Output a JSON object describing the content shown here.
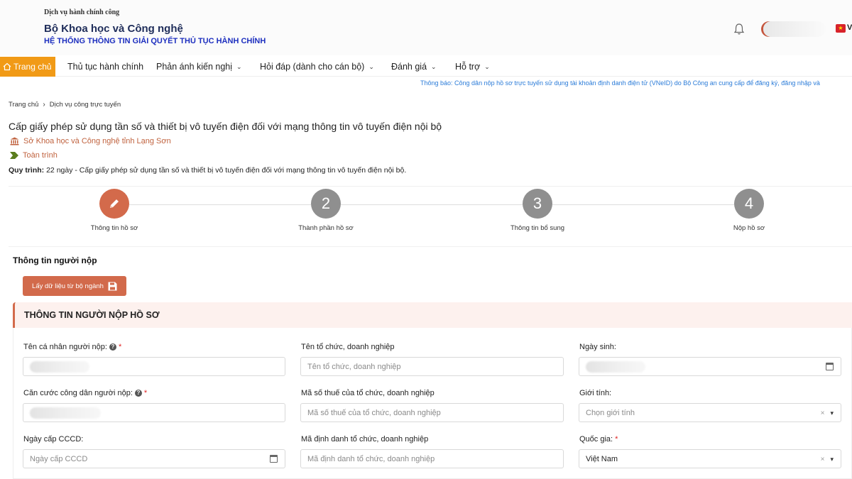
{
  "header": {
    "kicker": "Dịch vụ hành chính công",
    "ministry": "Bộ Khoa học và Công nghệ",
    "system": "HỆ THỐNG THÔNG TIN GIẢI QUYẾT THỦ TỤC HÀNH CHÍNH",
    "lang": "V"
  },
  "nav": {
    "home": "Trang chủ",
    "items": [
      {
        "label": "Thủ tục hành chính",
        "caret": ""
      },
      {
        "label": "Phản ánh kiến nghị",
        "caret": "⌄"
      },
      {
        "label": "Hỏi đáp (dành cho cán bộ)",
        "caret": "⌄"
      },
      {
        "label": "Đánh giá",
        "caret": "⌄"
      },
      {
        "label": "Hỗ trợ",
        "caret": "⌄"
      }
    ]
  },
  "notice": "Thông báo: Công dân nộp hồ sơ trực tuyến sử dụng tài khoản định danh điện tử (VNeID) do Bộ Công an cung cấp để đăng ký, đăng nhập và",
  "breadcrumb": {
    "home": "Trang chủ",
    "current": "Dịch vụ công trực tuyến"
  },
  "procedure": {
    "title": "Cấp giấy phép sử dụng tần số và thiết bị vô tuyến điện đối với mạng thông tin vô tuyến điện nội bộ",
    "agency": "Sở Khoa học và Công nghệ tỉnh Lạng Sơn",
    "scope": "Toàn trình",
    "process_label": "Quy trình:",
    "process_text": "22 ngày - Cấp giấy phép sử dụng tần số và thiết bị vô tuyến điện đối với mạng thông tin vô tuyến điện nội bộ."
  },
  "steps": [
    {
      "number": "",
      "label": "Thông tin hồ sơ",
      "active": true
    },
    {
      "number": "2",
      "label": "Thành phần hồ sơ",
      "active": false
    },
    {
      "number": "3",
      "label": "Thông tin bổ sung",
      "active": false
    },
    {
      "number": "4",
      "label": "Nộp hồ sơ",
      "active": false
    }
  ],
  "form": {
    "section_heading": "Thông tin người nộp",
    "fetch_button": "Lấy dữ liệu từ bộ ngành",
    "card_title": "THÔNG TIN NGƯỜI NỘP HỒ SƠ",
    "fields": {
      "applicant_name": {
        "label": "Tên cá nhân người nộp:",
        "required": "*"
      },
      "org_name": {
        "label": "Tên tổ chức, doanh nghiệp",
        "placeholder": "Tên tổ chức, doanh nghiệp"
      },
      "dob": {
        "label": "Ngày sinh:"
      },
      "citizen_id": {
        "label": "Căn cước công dân người nộp:",
        "required": "*"
      },
      "tax_code": {
        "label": "Mã số thuế của tổ chức, doanh nghiệp",
        "placeholder": "Mã số thuế của tổ chức, doanh nghiệp"
      },
      "gender": {
        "label": "Giới tính:",
        "placeholder": "Chọn giới tính"
      },
      "id_issue_date": {
        "label": "Ngày cấp CCCD:",
        "placeholder": "Ngày cấp CCCD"
      },
      "org_identifier": {
        "label": "Mã định danh tổ chức, doanh nghiệp",
        "placeholder": "Mã định danh tổ chức, doanh nghiệp"
      },
      "country": {
        "label": "Quốc gia:",
        "required": "*",
        "value": "Việt Nam"
      }
    },
    "clear_symbol": "×",
    "arrow_symbol": "▾"
  },
  "colors": {
    "accent": "#d36a4b",
    "nav_active": "#f19a16",
    "title_blue": "#1d2fbf",
    "notice": "#2a7bd8"
  }
}
